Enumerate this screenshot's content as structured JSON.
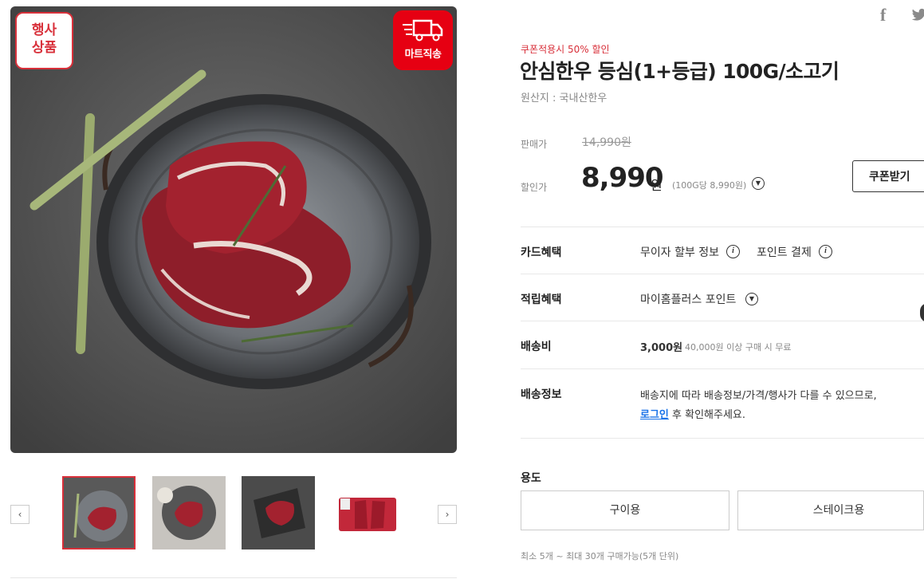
{
  "badges": {
    "event_line1": "행사",
    "event_line2": "상품",
    "mart": "마트직송"
  },
  "product": {
    "coupon_note": "쿠폰적용시 50% 할인",
    "title": "안심한우 등심(1+등급) 100G/소고기",
    "origin": "원산지 : 국내산한우"
  },
  "price": {
    "list_label": "판매가",
    "list_price": "14,990원",
    "sale_label": "할인가",
    "sale_price": "8,990",
    "won": "원",
    "unit_price": "(100G당 8,990원)",
    "coupon_button": "쿠폰받기"
  },
  "benefits": {
    "card_label": "카드혜택",
    "card_item1": "무이자 할부 정보",
    "card_item2": "포인트 결제",
    "points_label": "적립혜택",
    "points_item": "마이홈플러스 포인트",
    "shipping_fee_label": "배송비",
    "shipping_fee": "3,000원",
    "shipping_condition": "40,000원 이상 구매 시 무료",
    "shipping_info_label": "배송정보",
    "shipping_info_line1": "배송지에 따라 배송정보/가격/행사가 다를 수 있으므로,",
    "shipping_info_login": "로그인",
    "shipping_info_line2": " 후 확인해주세요."
  },
  "options": {
    "use_label": "용도",
    "choices": [
      "구이용",
      "스테이크용"
    ],
    "limit_note": "최소 5개 ~ 최대 30개 구매가능(5개 단위)"
  },
  "gallery": {
    "prev": "‹",
    "next": "›",
    "thumb_count": 4,
    "active_index": 0
  },
  "social": {
    "facebook": "f"
  },
  "colors": {
    "accent": "#d8303a",
    "mart_red": "#e60012",
    "link": "#1a73e8"
  },
  "icons": [
    "truck-icon",
    "facebook-icon",
    "twitter-icon",
    "info-icon",
    "chevron-down-icon",
    "chevron-left-icon",
    "chevron-right-icon"
  ]
}
